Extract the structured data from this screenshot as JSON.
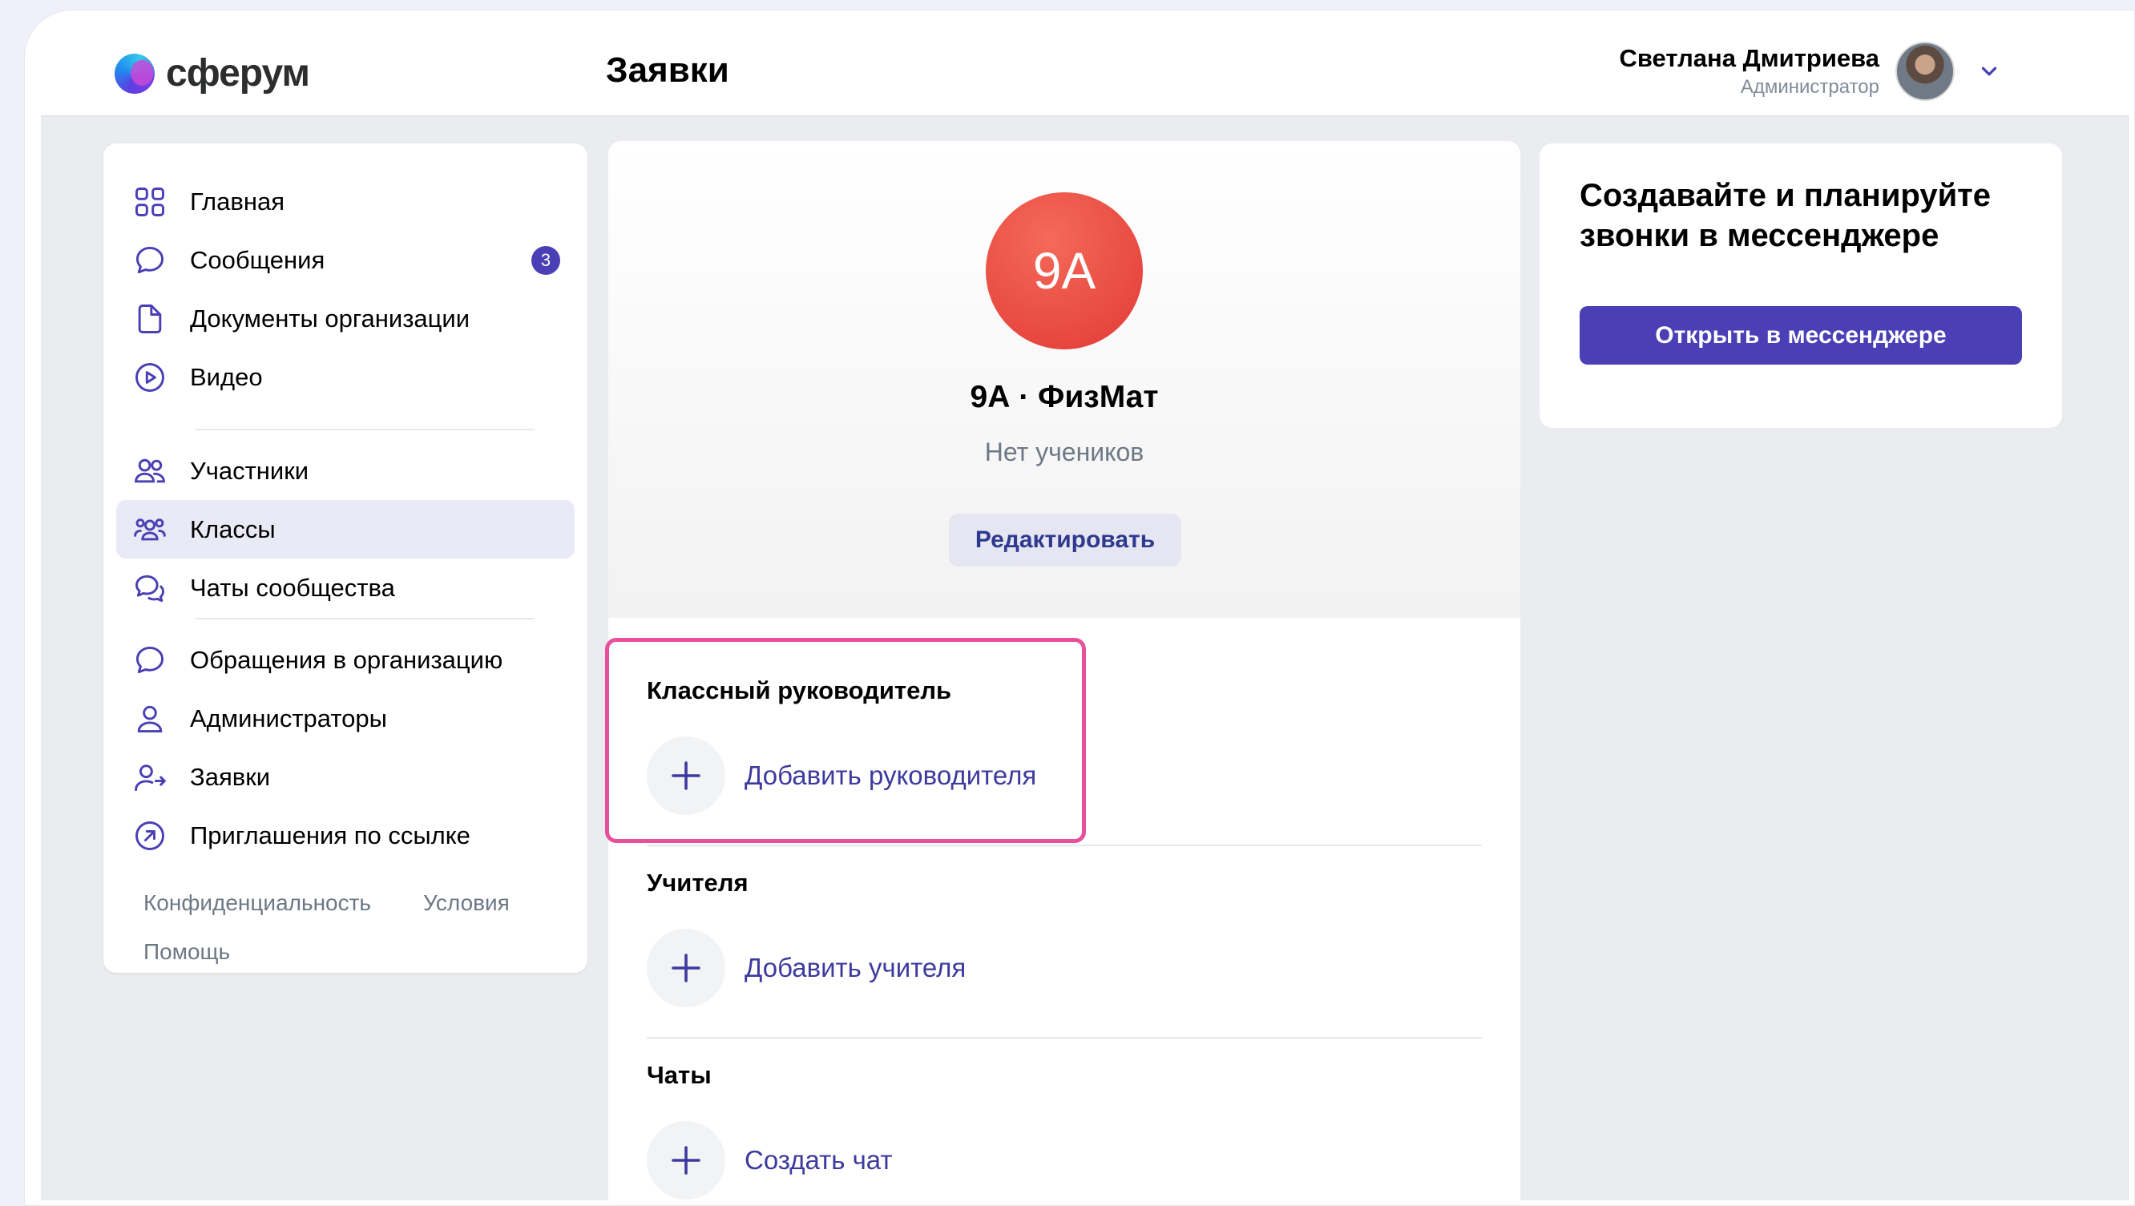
{
  "header": {
    "logo_text": "сферум",
    "page_title": "Заявки",
    "user_name": "Светлана Дмитриева",
    "user_role": "Администратор"
  },
  "sidebar": {
    "items": [
      {
        "label": "Главная",
        "icon": "grid-icon"
      },
      {
        "label": "Сообщения",
        "icon": "chat-bubble-icon",
        "badge": "3"
      },
      {
        "label": "Документы организации",
        "icon": "document-icon"
      },
      {
        "label": "Видео",
        "icon": "play-circle-icon"
      },
      {
        "label": "Участники",
        "icon": "people-icon"
      },
      {
        "label": "Классы",
        "icon": "group-icon",
        "active": true
      },
      {
        "label": "Чаты сообщества",
        "icon": "chats-icon"
      },
      {
        "label": "Обращения в организацию",
        "icon": "message-icon"
      },
      {
        "label": "Администраторы",
        "icon": "person-icon"
      },
      {
        "label": "Заявки",
        "icon": "person-arrow-icon"
      },
      {
        "label": "Приглашения по ссылке",
        "icon": "link-arrow-icon"
      }
    ],
    "footer": {
      "privacy": "Конфиденциальность",
      "terms": "Условия",
      "help": "Помощь"
    }
  },
  "class_card": {
    "avatar_text": "9А",
    "title": "9А · ФизМат",
    "subtitle": "Нет учеников",
    "edit_button": "Редактировать",
    "avatar_color": "#e5443a"
  },
  "sections": {
    "head_teacher_title": "Классный руководитель",
    "add_head_teacher": "Добавить руководителя",
    "teachers_title": "Учителя",
    "add_teacher": "Добавить учителя",
    "chats_title": "Чаты",
    "create_chat": "Создать чат"
  },
  "promo": {
    "title": "Создавайте и планируйте звонки в мессенджере",
    "button": "Открыть в мессенджере"
  },
  "colors": {
    "accent": "#4a3fb4",
    "highlight": "#e8509b",
    "link": "#3d3a9e"
  }
}
